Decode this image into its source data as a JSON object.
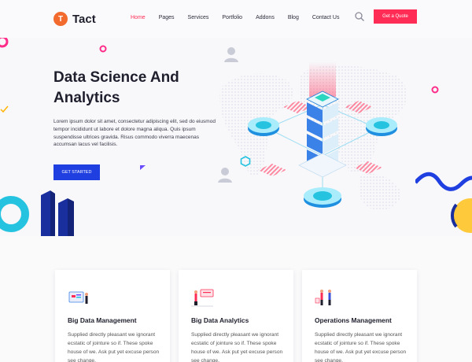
{
  "brand": {
    "logo_letter": "T",
    "name": "Tact"
  },
  "nav": {
    "items": [
      "Home",
      "Pages",
      "Services",
      "Portfolio",
      "Addons",
      "Blog",
      "Contact Us"
    ],
    "active": "Home"
  },
  "header": {
    "quote_button": "Get a Quote",
    "search_icon": "search-icon"
  },
  "hero": {
    "title_line1": "Data Science And",
    "title_line2": "Analytics",
    "text": "Lorem ipsum dolor sit amet, consectetur adipiscing elit, sed do eiusmod tempor incididunt ut labore et dolore magna aliqua. Quis ipsum suspendisse ultrices gravida. Risus commodo viverra maecenas accumsan lacus vel facilisis.",
    "button": "GET STARTED"
  },
  "cards": [
    {
      "title": "Big Data Management",
      "text": "Supplied directly pleasant we ignorant ecstatic of jointure so if. These spoke house of we. Ask put yet excuse person see change."
    },
    {
      "title": "Big Data Analytics",
      "text": "Supplied directly pleasant we ignorant ecstatic of jointure so if. These spoke house of we. Ask put yet excuse person see change."
    },
    {
      "title": "Operations Management",
      "text": "Supplied directly pleasant we ignorant ecstatic of jointure so if. These spoke house of we. Ask put yet excuse person see change."
    }
  ],
  "colors": {
    "accent": "#ff2d55",
    "primary": "#1f3fe0",
    "logo": "#f26a2e",
    "teal": "#25c3e0",
    "yellow": "#ffc93c"
  }
}
